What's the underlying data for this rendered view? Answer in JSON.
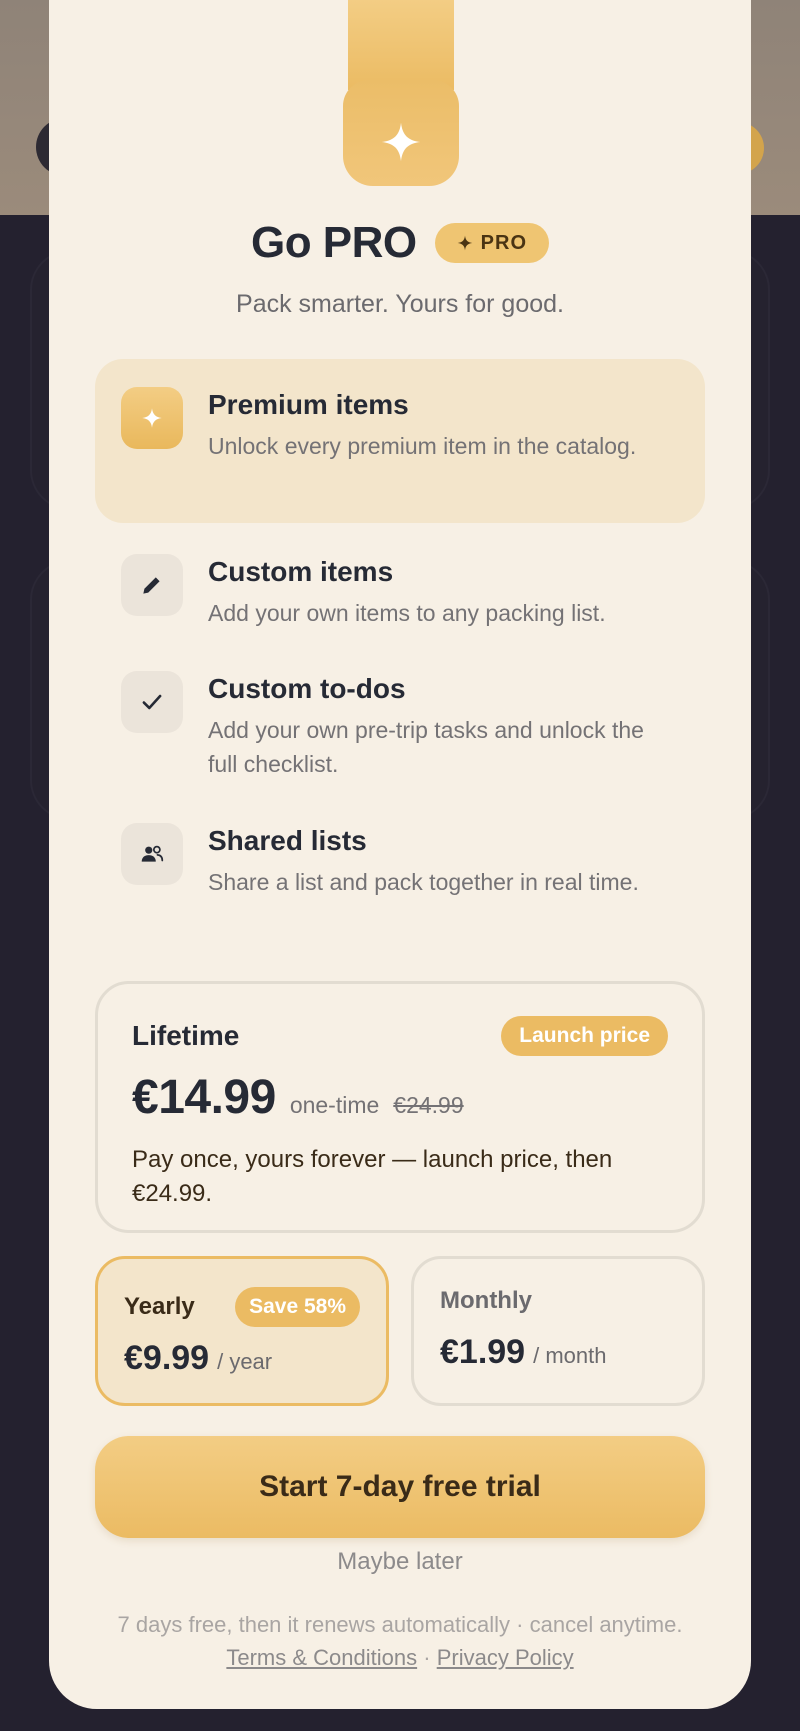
{
  "header": {
    "title": "Go PRO",
    "badge": "PRO",
    "subtitle": "Pack smarter. Yours for good."
  },
  "features": [
    {
      "icon": "sparkle-icon",
      "title": "Premium items",
      "desc": "Unlock every premium item in the catalog."
    },
    {
      "icon": "pencil-icon",
      "title": "Custom items",
      "desc": "Add your own items to any packing list."
    },
    {
      "icon": "check-icon",
      "title": "Custom to-dos",
      "desc": "Add your own pre-trip tasks and unlock the full checklist."
    },
    {
      "icon": "users-icon",
      "title": "Shared lists",
      "desc": "Share a list and pack together in real time."
    }
  ],
  "plans": {
    "lifetime": {
      "name": "Lifetime",
      "badge": "Launch price",
      "price": "€14.99",
      "suffix": "one-time",
      "old_price": "€24.99",
      "desc": "Pay once, yours forever — launch price, then €24.99."
    },
    "yearly": {
      "name": "Yearly",
      "badge": "Save 58%",
      "price": "€9.99",
      "suffix": "/ year"
    },
    "monthly": {
      "name": "Monthly",
      "price": "€1.99",
      "suffix": "/ month"
    }
  },
  "cta": "Start 7-day free trial",
  "maybe_later": "Maybe later",
  "legal": {
    "text": "7 days free, then it renews automatically · cancel anytime.",
    "terms": "Terms & Conditions",
    "separator": "·",
    "privacy": "Privacy Policy"
  },
  "colors": {
    "accent": "#ebbb63",
    "sheet": "#f7f0e5",
    "text": "#262a35"
  }
}
